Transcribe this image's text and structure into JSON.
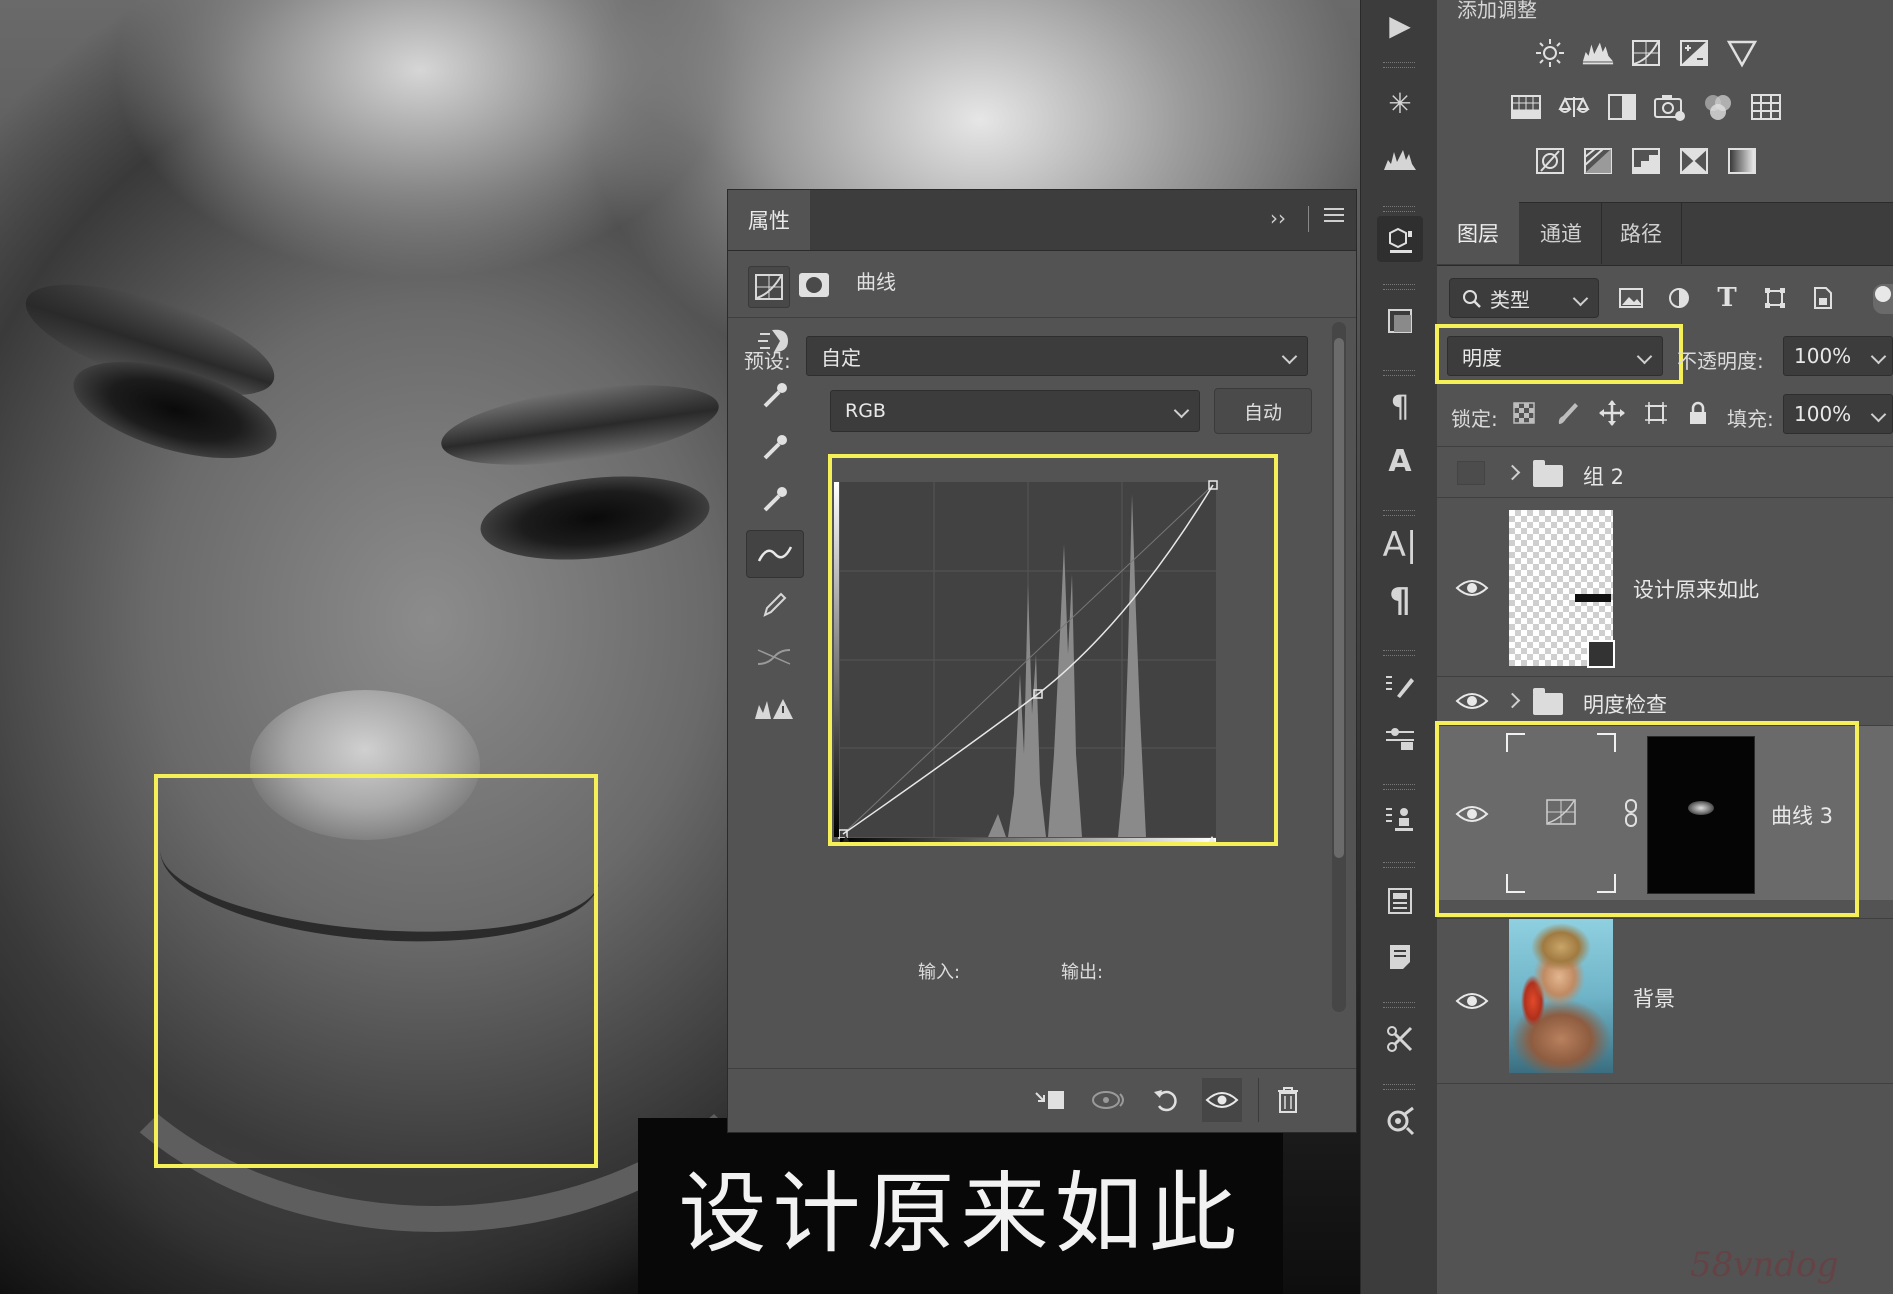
{
  "caption": {
    "text": "设计原来如此"
  },
  "properties_panel": {
    "tab_label": "属性",
    "adjustment_title": "曲线",
    "preset_label": "预设:",
    "preset_value": "自定",
    "channel_value": "RGB",
    "auto_label": "自动",
    "input_label": "输入:",
    "output_label": "输出:"
  },
  "adjustments_panel": {
    "title": "添加调整"
  },
  "layers_panel": {
    "tabs": [
      {
        "label": "图层"
      },
      {
        "label": "通道"
      },
      {
        "label": "路径"
      }
    ],
    "filter_value": "类型",
    "blend_mode": "明度",
    "opacity_label": "不透明度:",
    "opacity_value": "100%",
    "lock_label": "锁定:",
    "fill_label": "填充:",
    "fill_value": "100%",
    "layers": [
      {
        "name": "组 2",
        "type": "group",
        "visible": false
      },
      {
        "name": "设计原来如此",
        "type": "smart-object",
        "visible": true
      },
      {
        "name": "明度检查",
        "type": "group",
        "visible": true
      },
      {
        "name": "曲线 3",
        "type": "curves-adjustment",
        "visible": true,
        "selected": true
      },
      {
        "name": "背景",
        "type": "pixel",
        "visible": true
      }
    ]
  },
  "colors": {
    "highlight": "#f5ef58",
    "panel": "#535353",
    "panel_dark": "#3d3d3d"
  },
  "watermark": {
    "text": "58vndog"
  }
}
